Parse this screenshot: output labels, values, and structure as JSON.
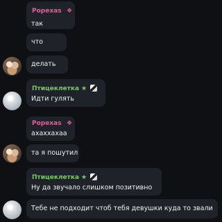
{
  "messages": [
    {
      "author": "Popexas",
      "text": "так"
    },
    {
      "text": "что"
    },
    {
      "text": "делать"
    },
    {
      "author": "Птицеклетка",
      "text": "Идти гулять"
    },
    {
      "author": "Popexas",
      "text": "ахаххахаа"
    },
    {
      "text": "та я пошутил"
    },
    {
      "author": "Птицеклетка",
      "text": "Ну да звучало слишком позитивно"
    },
    {
      "text": "Тебе не подходит чтоб тебя девушки куда то звали"
    }
  ],
  "badges": {
    "popexas": "❖",
    "pticekletka": "★"
  },
  "colors": {
    "popexas": "#e0619a",
    "pticekletka": "#7cc96a",
    "bubble": "#1f2329",
    "background": "#0e1014"
  }
}
